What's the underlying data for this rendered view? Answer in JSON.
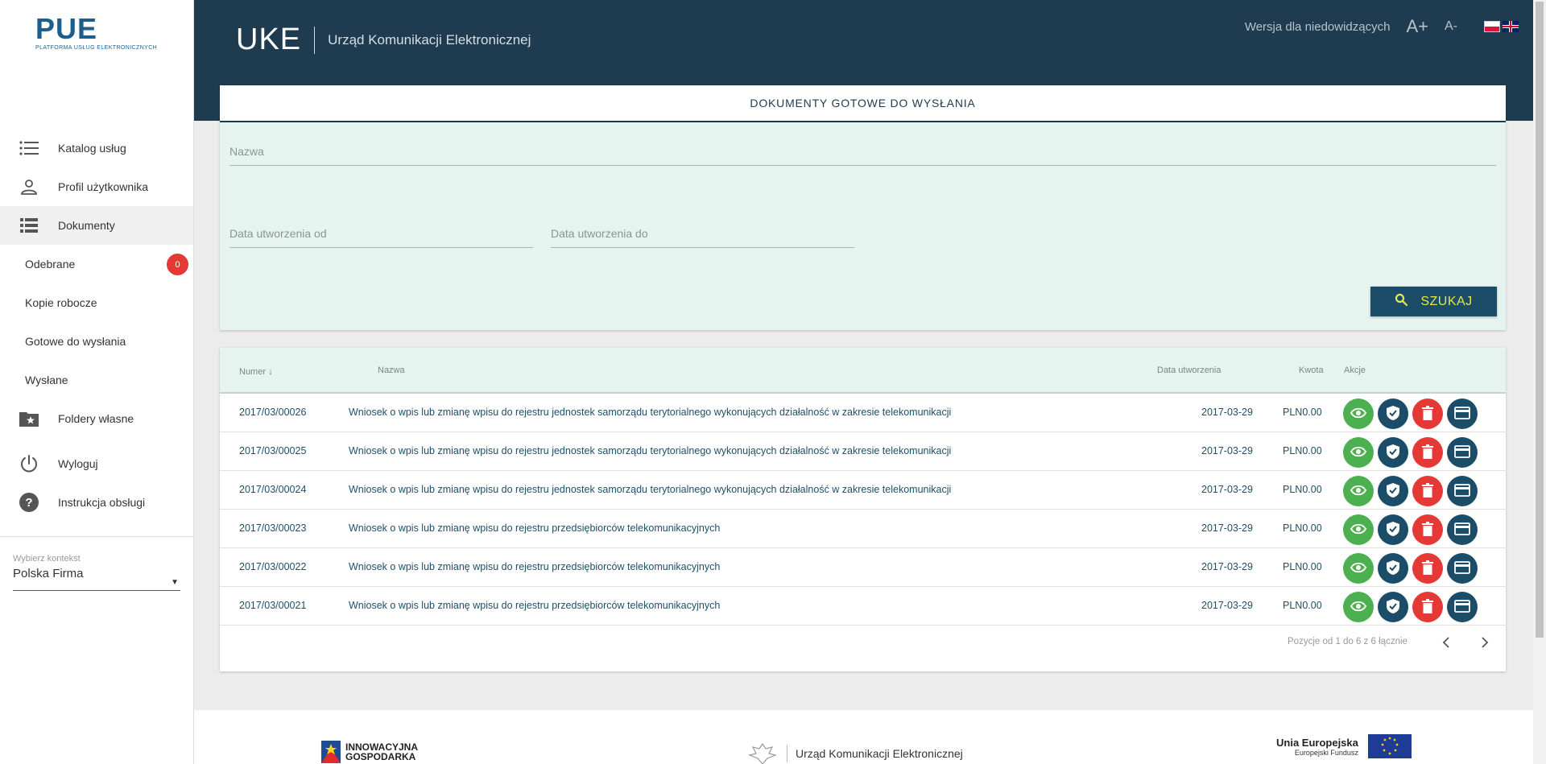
{
  "sidebar": {
    "logo": {
      "main": "PUE",
      "sub": "PLATFORMA USŁUG ELEKTRONICZNYCH"
    },
    "items": [
      {
        "label": "Katalog usług",
        "icon": "list-icon"
      },
      {
        "label": "Profil użytkownika",
        "icon": "person-icon"
      },
      {
        "label": "Dokumenty",
        "icon": "documents-icon"
      }
    ],
    "subitems": [
      {
        "label": "Odebrane",
        "badge": "0"
      },
      {
        "label": "Kopie robocze"
      },
      {
        "label": "Gotowe do wysłania"
      },
      {
        "label": "Wysłane"
      }
    ],
    "items2": [
      {
        "label": "Foldery własne",
        "icon": "folder-star-icon"
      },
      {
        "label": "Wyloguj",
        "icon": "power-icon"
      },
      {
        "label": "Instrukcja obsługi",
        "icon": "help-icon"
      }
    ],
    "context": {
      "label": "Wybierz kontekst",
      "value": "Polska Firma"
    }
  },
  "header": {
    "logo_mark": "UKE",
    "logo_name": "Urząd Komunikacji Elektronicznej",
    "accessibility": "Wersja dla niedowidzących",
    "font_plus": "A+",
    "font_minus": "A-"
  },
  "filter": {
    "title": "DOKUMENTY GOTOWE DO WYSŁANIA",
    "name_placeholder": "Nazwa",
    "date_from_placeholder": "Data utworzenia od",
    "date_to_placeholder": "Data utworzenia do",
    "search_label": "SZUKAJ"
  },
  "table": {
    "headers": {
      "number": "Numer",
      "name": "Nazwa",
      "date": "Data utworzenia",
      "amount": "Kwota",
      "actions": "Akcje"
    },
    "rows": [
      {
        "number": "2017/03/00026",
        "name": "Wniosek o wpis lub zmianę wpisu do rejestru jednostek samorządu terytorialnego wykonujących działalność w zakresie telekomunikacji",
        "date": "2017-03-29",
        "amount": "PLN0.00"
      },
      {
        "number": "2017/03/00025",
        "name": "Wniosek o wpis lub zmianę wpisu do rejestru jednostek samorządu terytorialnego wykonujących działalność w zakresie telekomunikacji",
        "date": "2017-03-29",
        "amount": "PLN0.00"
      },
      {
        "number": "2017/03/00024",
        "name": "Wniosek o wpis lub zmianę wpisu do rejestru jednostek samorządu terytorialnego wykonujących działalność w zakresie telekomunikacji",
        "date": "2017-03-29",
        "amount": "PLN0.00"
      },
      {
        "number": "2017/03/00023",
        "name": "Wniosek o wpis lub zmianę wpisu do rejestru przedsiębiorców telekomunikacyjnych",
        "date": "2017-03-29",
        "amount": "PLN0.00"
      },
      {
        "number": "2017/03/00022",
        "name": "Wniosek o wpis lub zmianę wpisu do rejestru przedsiębiorców telekomunikacyjnych",
        "date": "2017-03-29",
        "amount": "PLN0.00"
      },
      {
        "number": "2017/03/00021",
        "name": "Wniosek o wpis lub zmianę wpisu do rejestru przedsiębiorców telekomunikacyjnych",
        "date": "2017-03-29",
        "amount": "PLN0.00"
      }
    ],
    "pager_text": "Pozycje od 1 do 6 z 6 łącznie"
  },
  "footer": {
    "left": [
      "INNOWACYJNA",
      "GOSPODARKA"
    ],
    "center": "Urząd Komunikacji Elektronicznej",
    "right": [
      "Unia Europejska",
      "Europejski Fundusz"
    ]
  },
  "colors": {
    "header": "#1e3b50",
    "accent": "#1b4d69",
    "filter_bg": "#e6f4ef",
    "badge": "#e53935",
    "view": "#4caf50"
  }
}
